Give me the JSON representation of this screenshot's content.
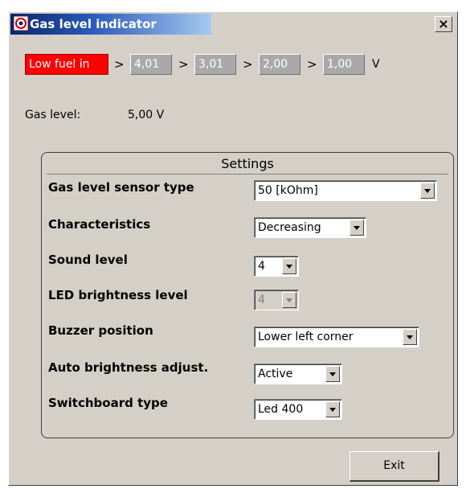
{
  "window": {
    "title": "Gas level indicator",
    "close_label": "×"
  },
  "thresholds": {
    "alarm_label": "Low fuel in",
    "separator": ">",
    "values": [
      "4,01",
      "3,01",
      "2,00",
      "1,00"
    ],
    "unit": "V"
  },
  "gas_level": {
    "label": "Gas level:",
    "value": "5,00 V"
  },
  "settings": {
    "title": "Settings",
    "rows": [
      {
        "label": "Gas level sensor type",
        "value": "50 [kOhm]",
        "enabled": true
      },
      {
        "label": "Characteristics",
        "value": "Decreasing",
        "enabled": true
      },
      {
        "label": "Sound level",
        "value": "4",
        "enabled": true
      },
      {
        "label": "LED brightness level",
        "value": "4",
        "enabled": false
      },
      {
        "label": "Buzzer position",
        "value": "Lower left corner",
        "enabled": true
      },
      {
        "label": "Auto brightness adjust.",
        "value": "Active",
        "enabled": true
      },
      {
        "label": "Switchboard type",
        "value": "Led 400",
        "enabled": true
      }
    ]
  },
  "exit_label": "Exit",
  "colors": {
    "alarm": "#ff0000",
    "title_bar": "#0a246a",
    "face": "#d4d0c8"
  }
}
